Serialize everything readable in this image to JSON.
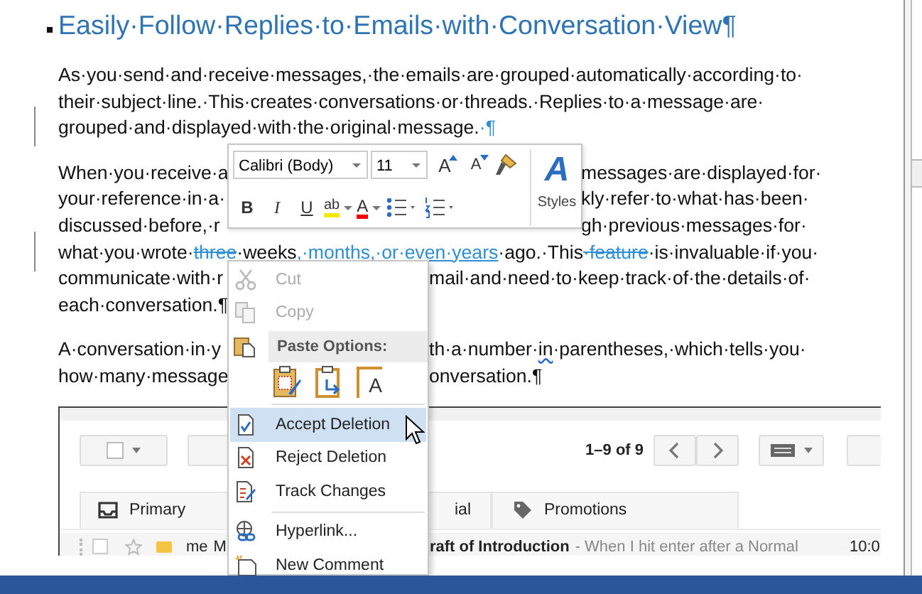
{
  "document": {
    "heading": "Easily·Follow·Replies·to·Emails·with·Conversation·View¶",
    "paragraphs": [
      {
        "lines": [
          {
            "changed": false,
            "left": [
              {
                "kind": "normal",
                "text": "As·you·send·and·receive·messages,·the·emails·are·grouped·automatically·according·to·"
              }
            ]
          },
          {
            "changed": false,
            "left": [
              {
                "kind": "normal",
                "text": "their·subject·line.·This·creates·conversations·or·threads.·Replies·to·a·message·are·"
              }
            ]
          },
          {
            "changed": true,
            "left": [
              {
                "kind": "normal",
                "text": "grouped·and·displayed·with·the·original·message."
              },
              {
                "kind": "mark",
                "text": "·¶"
              }
            ]
          }
        ]
      },
      {
        "lines": [
          {
            "changed": false,
            "left": [
              {
                "kind": "normal",
                "text": "When·you·receive·a"
              }
            ],
            "right": [
              {
                "kind": "normal",
                "text": "messages·are·displayed·for·"
              }
            ]
          },
          {
            "changed": false,
            "left": [
              {
                "kind": "normal",
                "text": "your·reference·in·a·"
              }
            ],
            "right": [
              {
                "kind": "normal",
                "text": "kly·refer·to·what·has·been·"
              }
            ]
          },
          {
            "changed": false,
            "left": [
              {
                "kind": "normal",
                "text": "discussed·before,·r"
              }
            ],
            "right": [
              {
                "kind": "normal",
                "text": "gh·previous·messages·for·"
              }
            ]
          },
          {
            "changed": true,
            "left": [
              {
                "kind": "normal",
                "text": "what·you·wrote·"
              },
              {
                "kind": "deleted",
                "text": "three"
              },
              {
                "kind": "normal",
                "text": "·weeks"
              },
              {
                "kind": "inserted",
                "text": ",·months,·or·even·years"
              },
              {
                "kind": "normal",
                "text": "·ago.·This"
              },
              {
                "kind": "deleted",
                "text": "·feature"
              },
              {
                "kind": "normal",
                "text": "·is·invaluable·if·you·"
              }
            ]
          },
          {
            "changed": false,
            "left": [
              {
                "kind": "normal",
                "text": "communicate·with·r"
              }
            ],
            "right": [
              {
                "kind": "normal",
                "text": "mail·and·need·to·keep·track·of·the·details·of·"
              }
            ]
          },
          {
            "changed": false,
            "left": [
              {
                "kind": "normal",
                "text": "each·conversation.¶"
              }
            ]
          }
        ]
      },
      {
        "lines": [
          {
            "changed": false,
            "left": [
              {
                "kind": "normal",
                "text": "A·conversation·in·y"
              }
            ],
            "right": [
              {
                "kind": "normal",
                "text": "th·a·number·"
              },
              {
                "kind": "spelling",
                "text": "in"
              },
              {
                "kind": "normal",
                "text": "·parentheses,·which·tells·you·"
              }
            ]
          },
          {
            "changed": false,
            "left": [
              {
                "kind": "normal",
                "text": "how·many·message"
              }
            ],
            "right": [
              {
                "kind": "normal",
                "text": "onversation.¶"
              }
            ]
          }
        ]
      }
    ]
  },
  "embedded_screenshot": {
    "page_info": "1–9 of 9",
    "tabs": [
      {
        "label": "Primary"
      },
      {
        "label": "ial"
      },
      {
        "label": "Promotions"
      }
    ],
    "email_row": {
      "checked": false,
      "sender": "me",
      "sender_cut": "M",
      "subject": "raft of Introduction",
      "snippet": "- When I hit enter after a Normal",
      "time": "10:0"
    }
  },
  "mini_toolbar": {
    "font": "Calibri (Body)",
    "size": "11",
    "grow_glyph": "A",
    "shrink_glyph": "A",
    "styles_glyph": "A",
    "styles_label": "Styles",
    "format_buttons": [
      {
        "label": "B"
      },
      {
        "label": "I"
      },
      {
        "label": "U"
      }
    ],
    "highlight_glyph": "ab",
    "font_color_glyph": "A"
  },
  "context_menu": [
    {
      "kind": "item",
      "label": "Cut",
      "disabled": true,
      "selected": false
    },
    {
      "kind": "item",
      "label": "Copy",
      "disabled": true,
      "selected": false
    },
    {
      "kind": "header",
      "label": "Paste Options:"
    },
    {
      "kind": "paste_row",
      "glyph": "A"
    },
    {
      "kind": "separator"
    },
    {
      "kind": "item",
      "label": "Accept Deletion",
      "disabled": false,
      "selected": true
    },
    {
      "kind": "item",
      "label": "Reject Deletion",
      "disabled": false,
      "selected": false
    },
    {
      "kind": "item",
      "label": "Track Changes",
      "disabled": false,
      "selected": false
    },
    {
      "kind": "separator"
    },
    {
      "kind": "item",
      "label": "Hyperlink...",
      "disabled": false,
      "selected": false
    },
    {
      "kind": "item",
      "label": "New Comment",
      "disabled": false,
      "selected": false
    }
  ]
}
